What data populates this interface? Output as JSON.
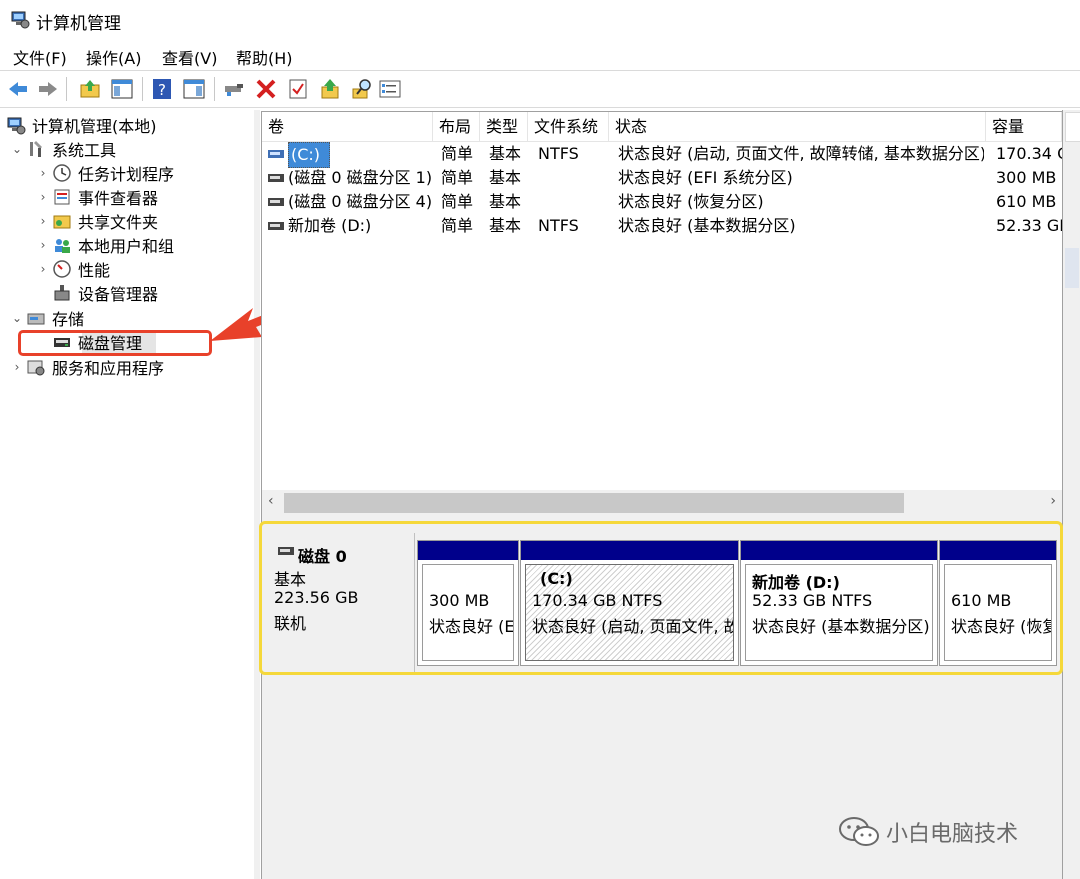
{
  "window": {
    "title": "计算机管理"
  },
  "menu": [
    "文件(F)",
    "操作(A)",
    "查看(V)",
    "帮助(H)"
  ],
  "toolbar": {
    "icons": [
      "back-icon",
      "forward-icon",
      "up-folder-icon",
      "show-hide-tree-icon",
      "help-icon",
      "action-pane-icon",
      "connect-icon",
      "delete-icon",
      "properties-icon",
      "export-icon",
      "search-icon",
      "details-icon"
    ]
  },
  "tree": {
    "root": "计算机管理(本地)",
    "system_tools": "系统工具",
    "task_scheduler": "任务计划程序",
    "event_viewer": "事件查看器",
    "shared_folders": "共享文件夹",
    "local_users": "本地用户和组",
    "performance": "性能",
    "device_manager": "设备管理器",
    "storage": "存储",
    "disk_management": "磁盘管理",
    "services_apps": "服务和应用程序"
  },
  "volume_list": {
    "columns": [
      "卷",
      "布局",
      "类型",
      "文件系统",
      "状态",
      "容量"
    ],
    "rows": [
      {
        "volume": "(C:)",
        "layout": "简单",
        "type": "基本",
        "fs": "NTFS",
        "status": "状态良好 (启动, 页面文件, 故障转储, 基本数据分区)",
        "capacity": "170.34 G"
      },
      {
        "volume": "(磁盘 0 磁盘分区 1)",
        "layout": "简单",
        "type": "基本",
        "fs": "",
        "status": "状态良好 (EFI 系统分区)",
        "capacity": "300 MB"
      },
      {
        "volume": "(磁盘 0 磁盘分区 4)",
        "layout": "简单",
        "type": "基本",
        "fs": "",
        "status": "状态良好 (恢复分区)",
        "capacity": "610 MB"
      },
      {
        "volume": "新加卷 (D:)",
        "layout": "简单",
        "type": "基本",
        "fs": "NTFS",
        "status": "状态良好 (基本数据分区)",
        "capacity": "52.33 GE"
      }
    ]
  },
  "scroll": {
    "left": "‹",
    "right": "›"
  },
  "disk": {
    "name": "磁盘 0",
    "type": "基本",
    "size": "223.56 GB",
    "state": "联机",
    "partitions": [
      {
        "name": "",
        "size": "300 MB",
        "status": "状态良好 (E"
      },
      {
        "name": "(C:)",
        "size": "170.34 GB NTFS",
        "status": "状态良好 (启动, 页面文件, 故"
      },
      {
        "name": "新加卷 (D:)",
        "size": "52.33 GB NTFS",
        "status": "状态良好 (基本数据分区)"
      },
      {
        "name": "",
        "size": "610 MB",
        "status": "状态良好 (恢复"
      }
    ]
  },
  "watermark": "小白电脑技术",
  "colors": {
    "partition_bar": "#00008b",
    "highlight_red": "#e8412a",
    "highlight_yellow": "#f5d83a"
  }
}
